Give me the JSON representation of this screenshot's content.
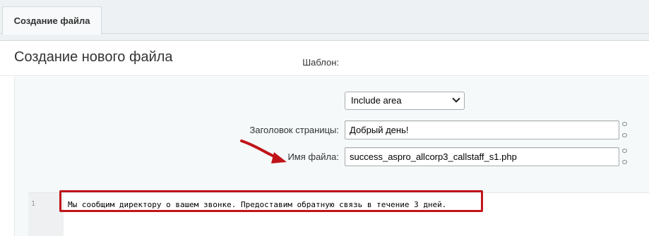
{
  "tabs": [
    {
      "label": "Создание файла"
    }
  ],
  "page_title": "Создание нового файла",
  "form": {
    "template_label": "Шаблон:",
    "template_value": "Include area",
    "title_label": "Заголовок страницы:",
    "title_value": "Добрый день!",
    "filename_label": "Имя файла:",
    "filename_value": "success_aspro_allcorp3_callstaff_s1.php"
  },
  "editor": {
    "line_number": "1",
    "line_text": "Мы сообщим директору о вашем звонке. Предоставим обратную связь в течение 3 дней."
  },
  "colors": {
    "annotation": "#c0141a",
    "tab_bg": "#f7f9fa",
    "form_bg": "#f5f9f9"
  }
}
